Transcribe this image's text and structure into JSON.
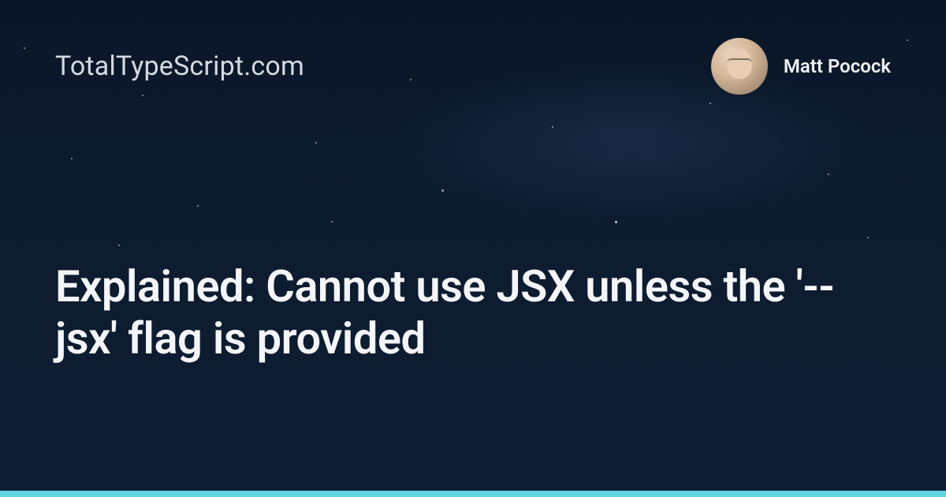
{
  "site_name": "TotalTypeScript.com",
  "author": {
    "name": "Matt Pocock"
  },
  "title": "Explained: Cannot use JSX unless the '--jsx' flag is provided",
  "accent_color": "#5ed4e0"
}
